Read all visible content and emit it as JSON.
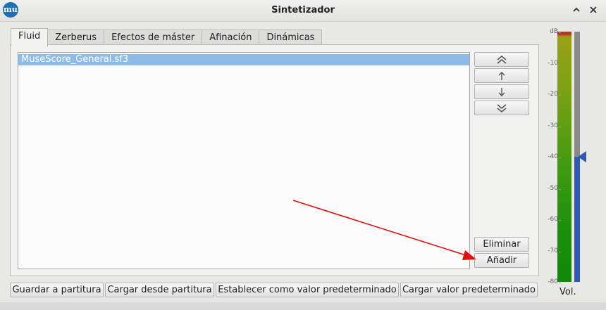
{
  "window": {
    "title": "Sintetizador",
    "logo_text": "mu"
  },
  "tabs": [
    {
      "label": "Fluid",
      "active": true
    },
    {
      "label": "Zerberus",
      "active": false
    },
    {
      "label": "Efectos de máster",
      "active": false
    },
    {
      "label": "Afinación",
      "active": false
    },
    {
      "label": "Dinámicas",
      "active": false
    }
  ],
  "soundfonts": [
    "MuseScore_General.sf3"
  ],
  "side_buttons": {
    "move_top_icon": "double-chevron-up-icon",
    "move_up_icon": "arrow-up-icon",
    "move_down_icon": "arrow-down-icon",
    "move_bottom_icon": "double-chevron-down-icon",
    "remove_label": "Eliminar",
    "add_label": "Añadir"
  },
  "bottom_buttons": {
    "save_to_score": "Guardar a partitura",
    "load_from_score": "Cargar desde partitura",
    "set_as_default": "Establecer como valor predeterminado",
    "load_default": "Cargar valor predeterminado"
  },
  "meter": {
    "scale": [
      "dB",
      "-10",
      "-20",
      "-30",
      "-40",
      "-50",
      "-60",
      "-70",
      "-80"
    ],
    "volume_label": "Vol.",
    "volume_db": -40
  },
  "colors": {
    "selection": "#8fbbe8",
    "slider": "#2a5bb5",
    "annotation_arrow": "#e01010"
  }
}
